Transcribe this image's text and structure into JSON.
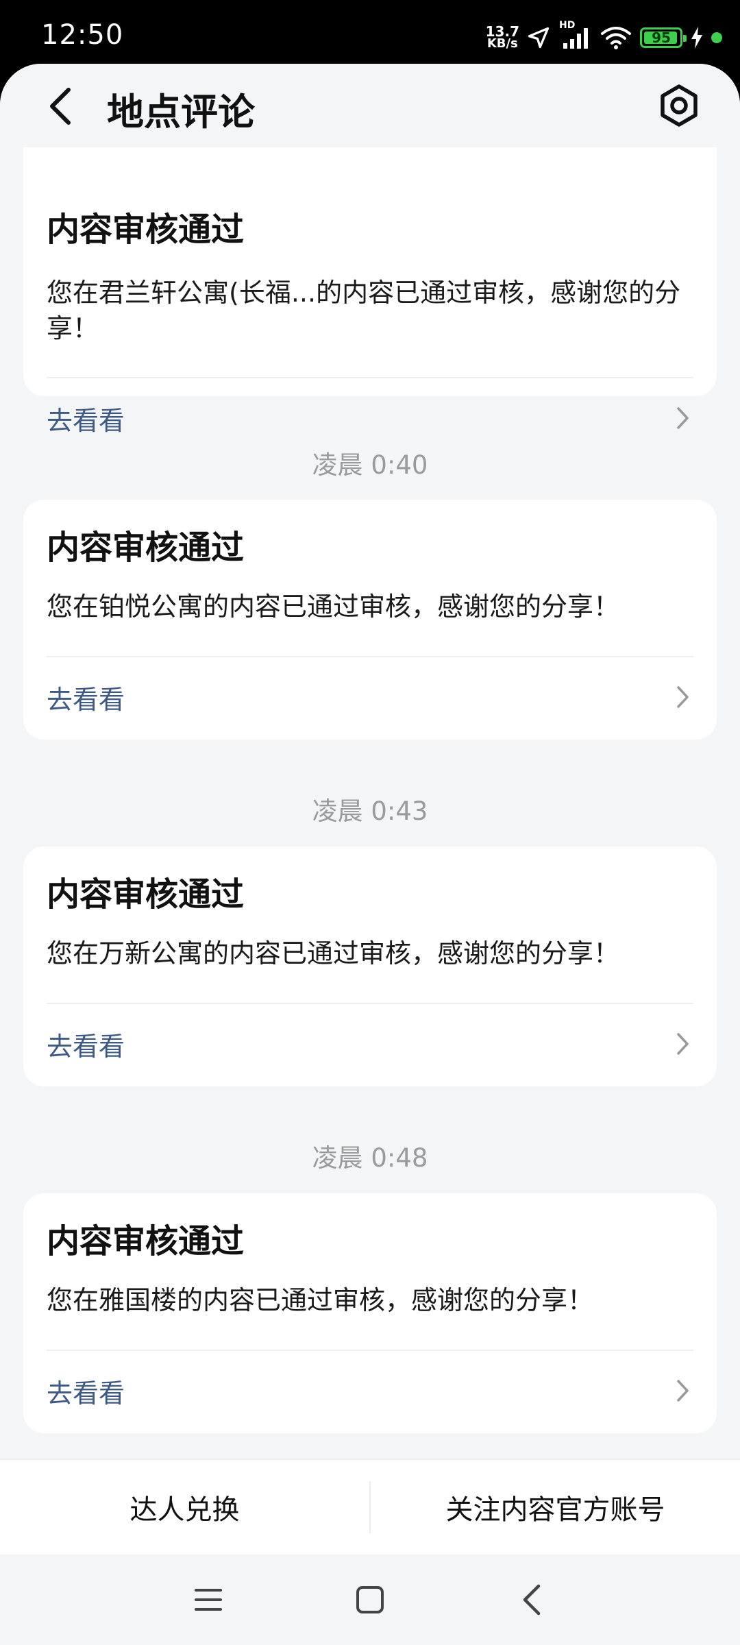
{
  "status_bar": {
    "time": "12:50",
    "net_speed_value": "13.7",
    "net_speed_unit": "KB/s",
    "network_label": "HD",
    "battery_level": "95",
    "battery_fraction": 0.95,
    "charging": true,
    "icons": [
      "navigation-arrow-icon",
      "signal-icon",
      "wifi-icon",
      "battery-icon",
      "charging-bolt-icon"
    ]
  },
  "header": {
    "title": "地点评论",
    "back_icon": "back-chevron-icon",
    "settings_icon": "settings-hexagon-icon"
  },
  "feed": {
    "cards": [
      {
        "title": "内容审核通过",
        "body": "您在君兰轩公寓(长福...的内容已通过审核，感谢您的分享！",
        "link_label": "去看看"
      },
      {
        "timestamp": "凌晨 0:40",
        "title": "内容审核通过",
        "body": "您在铂悦公寓的内容已通过审核，感谢您的分享！",
        "link_label": "去看看"
      },
      {
        "timestamp": "凌晨 0:43",
        "title": "内容审核通过",
        "body": "您在万新公寓的内容已通过审核，感谢您的分享！",
        "link_label": "去看看"
      },
      {
        "timestamp": "凌晨 0:48",
        "title": "内容审核通过",
        "body": "您在雅国楼的内容已通过审核，感谢您的分享！",
        "link_label": "去看看"
      }
    ]
  },
  "action_bar": {
    "left_label": "达人兑换",
    "right_label": "关注内容官方账号"
  },
  "nav_bar": {
    "icons": [
      "menu-icon",
      "home-square-icon",
      "back-triangle-icon"
    ]
  },
  "colors": {
    "background": "#f4f5f7",
    "card": "#ffffff",
    "link": "#3c5a85",
    "timestamp": "#9a9a9a",
    "battery": "#3ecf4c"
  }
}
